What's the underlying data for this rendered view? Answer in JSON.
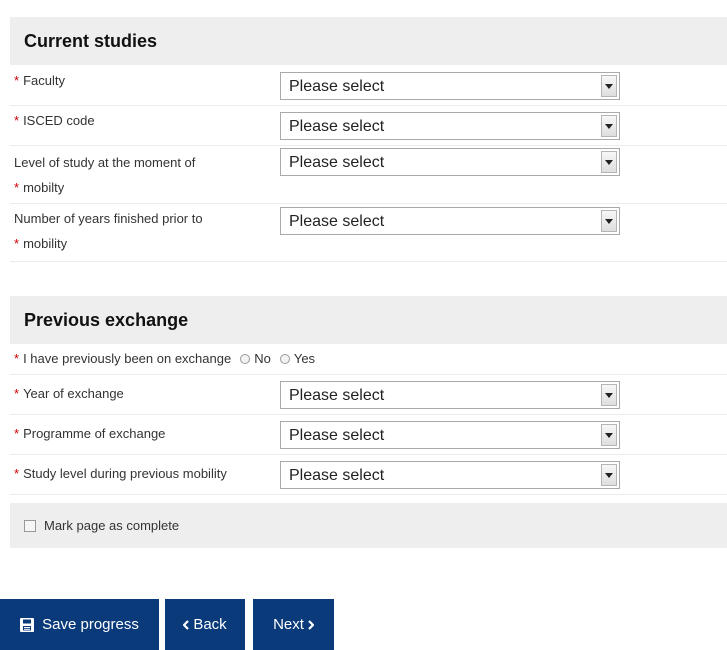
{
  "current_studies": {
    "title": "Current studies",
    "rows": [
      {
        "label_line1": "Faculty",
        "value": "Please select"
      },
      {
        "label_line1": "ISCED code",
        "value": "Please select"
      },
      {
        "label_line1": "Level of study at the moment of",
        "label_line2": "mobilty",
        "value": "Please select"
      },
      {
        "label_line1": "Number of years finished prior to",
        "label_line2": "mobility",
        "value": "Please select"
      }
    ]
  },
  "previous_exchange": {
    "title": "Previous exchange",
    "question": "I have previously been on exchange",
    "option_no": "No",
    "option_yes": "Yes",
    "rows": [
      {
        "label": "Year of exchange",
        "value": "Please select"
      },
      {
        "label": "Programme of exchange",
        "value": "Please select"
      },
      {
        "label": "Study level during previous mobility",
        "value": "Please select"
      }
    ]
  },
  "mark_complete": "Mark page as complete",
  "buttons": {
    "save": "Save progress",
    "back": "Back",
    "next": "Next"
  },
  "colors": {
    "button_bg": "#0a3a7a",
    "required": "#cc0000",
    "section_bg": "#eeeeee"
  }
}
